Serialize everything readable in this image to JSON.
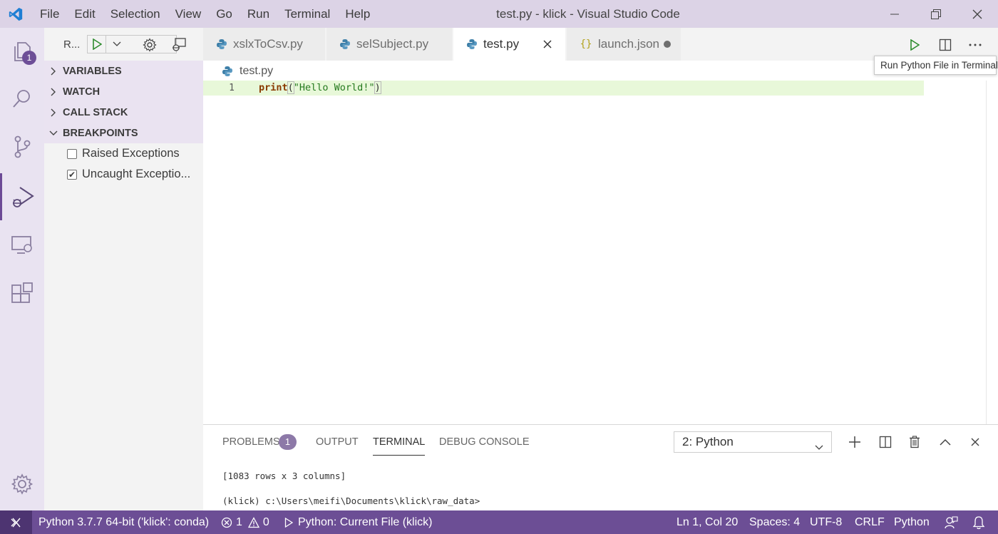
{
  "titlebar": {
    "menu": [
      "File",
      "Edit",
      "Selection",
      "View",
      "Go",
      "Run",
      "Terminal",
      "Help"
    ],
    "title": "test.py - klick - Visual Studio Code"
  },
  "activitybar": {
    "explorer_badge": "1"
  },
  "sidebar": {
    "config_name": "R...",
    "sections": [
      "VARIABLES",
      "WATCH",
      "CALL STACK",
      "BREAKPOINTS"
    ],
    "breakpoints": [
      {
        "label": "Raised Exceptions",
        "checked": false
      },
      {
        "label": "Uncaught Exceptio...",
        "checked": true
      }
    ]
  },
  "tabs": [
    {
      "label": "xslxToCsv.py",
      "active": false
    },
    {
      "label": "selSubject.py",
      "active": false
    },
    {
      "label": "test.py",
      "active": true
    },
    {
      "label": "launch.json",
      "active": false,
      "dirty": true
    }
  ],
  "tooltip": "Run Python File in Terminal",
  "editor": {
    "breadcrumb": "test.py",
    "line_number": "1",
    "code": {
      "fn": "print",
      "open_paren": "(",
      "string": "\"Hello World!\"",
      "close_paren": ")"
    }
  },
  "panel": {
    "tabs": [
      "PROBLEMS",
      "OUTPUT",
      "TERMINAL",
      "DEBUG CONSOLE"
    ],
    "problems_count": "1",
    "active_tab": "TERMINAL",
    "terminal_select": "2: Python",
    "terminal_lines": [
      "[1083 rows x 3 columns]",
      "(klick) c:\\Users\\meifi\\Documents\\klick\\raw_data>"
    ]
  },
  "statusbar": {
    "interpreter": "Python 3.7.7 64-bit ('klick': conda)",
    "errors": "1",
    "warnings": "0",
    "debug_config": "Python: Current File (klick)",
    "position": "Ln 1, Col 20",
    "spaces": "Spaces: 4",
    "encoding": "UTF-8",
    "eol": "CRLF",
    "language": "Python"
  },
  "colors": {
    "titlebar_bg": "#dcd3e6",
    "activitybar_bg": "#e9e3f1",
    "statusbar_bg": "#6c4e95",
    "accent": "#6d4e97"
  }
}
